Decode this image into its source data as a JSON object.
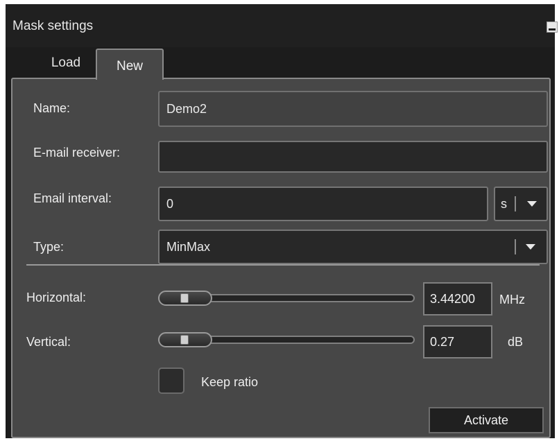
{
  "window": {
    "title": "Mask settings"
  },
  "tabs": [
    {
      "label": "Load",
      "active": false
    },
    {
      "label": "New",
      "active": true
    }
  ],
  "form": {
    "name": {
      "label": "Name:",
      "value": "Demo2"
    },
    "email_receiver": {
      "label": "E-mail receiver:",
      "value": ""
    },
    "email_interval": {
      "label": "Email interval:",
      "value": "0",
      "unit": "s"
    },
    "type": {
      "label": "Type:",
      "value": "MinMax"
    }
  },
  "sliders": {
    "horizontal": {
      "label": "Horizontal:",
      "value": "3.44200",
      "unit": "MHz"
    },
    "vertical": {
      "label": "Vertical:",
      "value": "0.27",
      "unit": "dB"
    }
  },
  "keep_ratio": {
    "label": "Keep ratio",
    "checked": false
  },
  "actions": {
    "activate_label": "Activate"
  },
  "icons": {
    "minimize": "minimize-icon",
    "dropdown": "chevron-down-icon"
  },
  "colors": {
    "panel_bg": "#474747",
    "window_bg": "#1c1c1c",
    "field_bg": "#282828"
  }
}
